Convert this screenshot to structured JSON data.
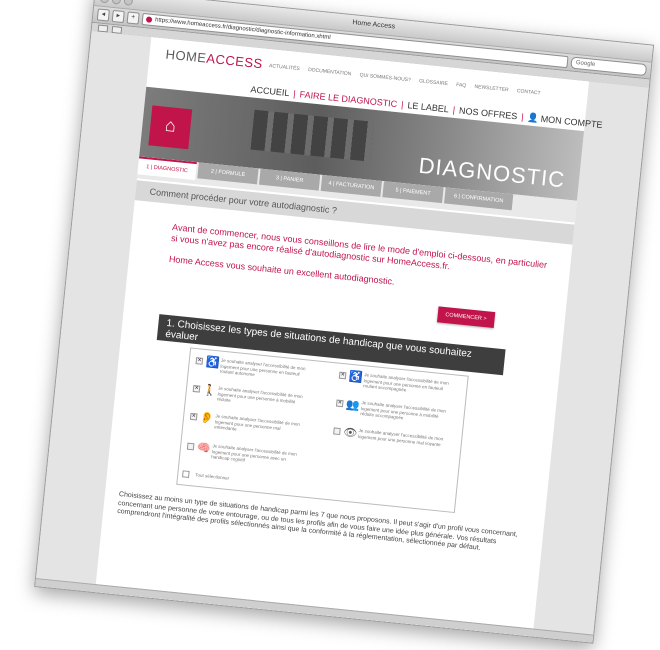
{
  "browser": {
    "window_title": "Home Access",
    "url": "https://www.homeaccess.fr/diagnostic/diagnostic-information.xhtml",
    "search_placeholder": "Google"
  },
  "site": {
    "logo_home": "HOME",
    "logo_access": "ACCESS",
    "top_nav": [
      "ACTUALITÉS",
      "DOCUMENTATION",
      "QUI SOMMES-NOUS?",
      "GLOSSAIRE",
      "FAQ",
      "NEWSLETTER",
      "CONTACT"
    ],
    "partner_label": "HomeAccess",
    "main_nav": {
      "accueil": "ACCUEIL",
      "faire": "FAIRE LE DIAGNOSTIC",
      "label": "LE LABEL",
      "offres": "NOS OFFRES",
      "compte": "MON COMPTE"
    },
    "banner_title": "DIAGNOSTIC"
  },
  "steps": [
    "1 | DIAGNOSTIC",
    "2 | FORMULE",
    "3 | PANIER",
    "4 | FACTURATION",
    "5 | PAIEMENT",
    "6 | CONFIRMATION"
  ],
  "question": "Comment procéder pour votre autodiagnostic ?",
  "intro": {
    "p1": "Avant de commencer, nous vous conseillons de lire le mode d'emploi ci-dessous, en particulier si vous n'avez pas encore réalisé d'autodiagnostic sur HomeAccess.fr.",
    "p2": "Home Access vous souhaite un excellent autodiagnostic.",
    "start_button": "COMMENCER  >"
  },
  "section_title": "1. Choisissez les types de situations de handicap que vous souhaitez évaluer",
  "options": [
    {
      "text": "Je souhaite analyser l'accessibilité de mon logement pour une personne en fauteuil roulant autonome",
      "checked": "✕",
      "icon": "wheelchair-icon",
      "glyph": "♿"
    },
    {
      "text": "Je souhaite analyser l'accessibilité de mon logement pour une personne en fauteuil roulant accompagnée",
      "checked": "✕",
      "icon": "wheelchair-assisted-icon",
      "glyph": "♿"
    },
    {
      "text": "Je souhaite analyser l'accessibilité de mon logement pour une personne à mobilité réduite",
      "checked": "✕",
      "icon": "reduced-mobility-icon",
      "glyph": "🚶"
    },
    {
      "text": "Je souhaite analyser l'accessibilité de mon logement pour une personne à mobilité réduite accompagnée",
      "checked": "✕",
      "icon": "reduced-mobility-assisted-icon",
      "glyph": "👥"
    },
    {
      "text": "Je souhaite analyser l'accessibilité de mon logement pour une personne mal entendante",
      "checked": "✕",
      "icon": "hearing-impaired-icon",
      "glyph": "👂"
    },
    {
      "text": "Je souhaite analyser l'accessibilité de mon logement pour une personne mal voyante",
      "checked": "",
      "icon": "visually-impaired-icon",
      "glyph": "👁"
    },
    {
      "text": "Je souhaite analyser l'accessibilité de mon logement pour une personne avec un handicap cognitif",
      "checked": "",
      "icon": "cognitive-icon",
      "glyph": "🧠"
    }
  ],
  "select_all": "Tout sélectionner",
  "paragraph": "Choisissez au moins un type de situations de handicap parmi les 7 que nous proposons. Il peut s'agir d'un profil vous concernant, concernant une personne de votre entourage, ou de tous les profils afin de vous faire une idée plus générale. Vos résultats comprendront l'intégralité des profils sélectionnés ainsi que la conformité à la réglementation, sélectionnée par défaut.",
  "colors": {
    "accent": "#c0144b",
    "dark_bar": "#3e3e3e"
  }
}
